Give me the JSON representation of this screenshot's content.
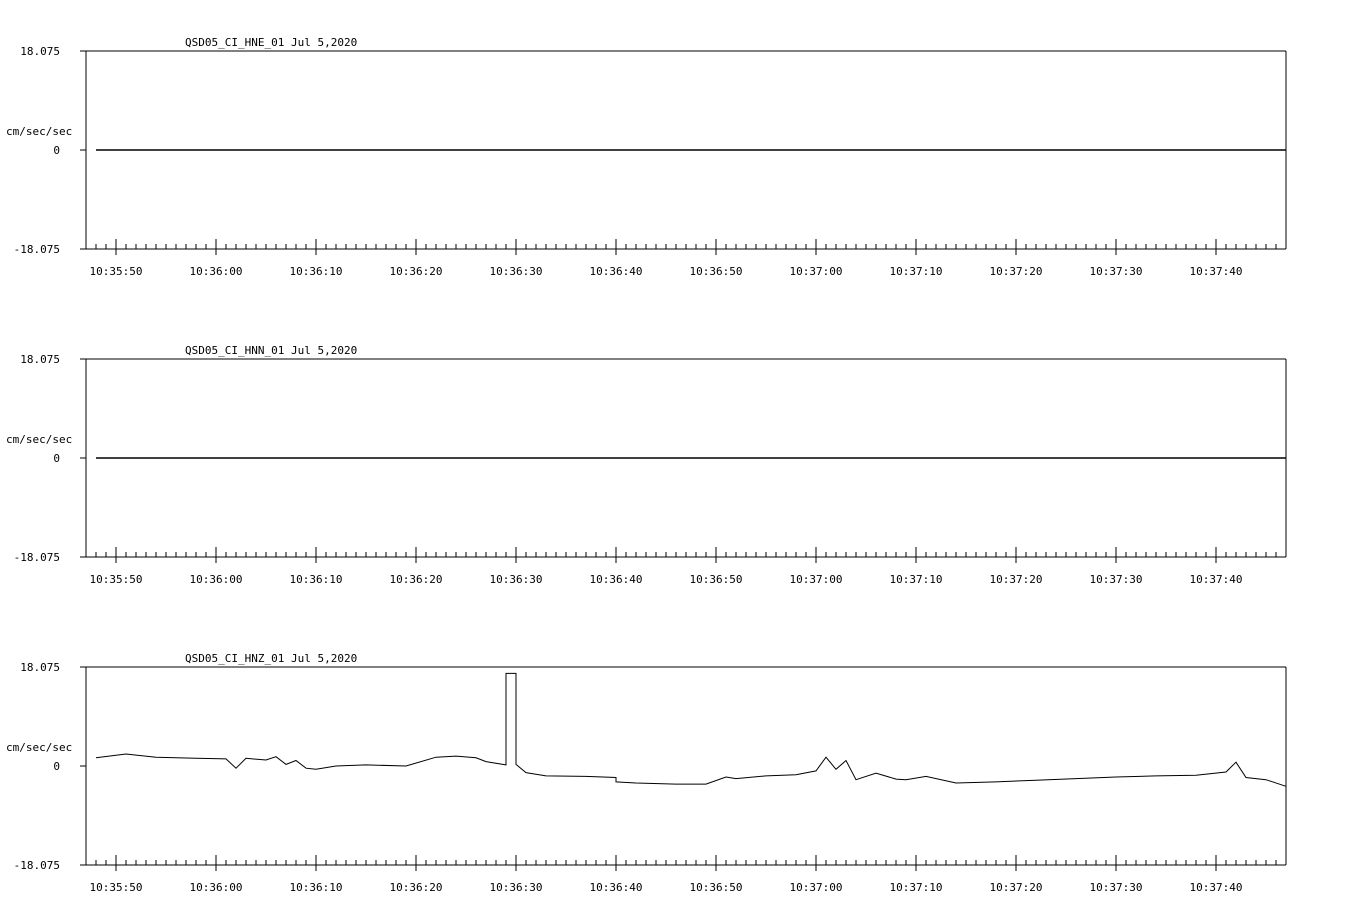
{
  "colors": {
    "background": "#ffffff",
    "trace": "#000000",
    "axis": "#000000"
  },
  "chart_data": [
    {
      "type": "line",
      "title": "QSD05_CI_HNE_01  Jul 5,2020",
      "ylabel": "cm/sec/sec",
      "ylim": [
        -18.075,
        18.075
      ],
      "ytick_labels": [
        "18.075",
        "0",
        "-18.075"
      ],
      "xlim": [
        "10:35:47",
        "10:37:47"
      ],
      "xtick_labels": [
        "10:35:50",
        "10:36:00",
        "10:36:10",
        "10:36:20",
        "10:36:30",
        "10:36:40",
        "10:36:50",
        "10:37:00",
        "10:37:10",
        "10:37:20",
        "10:37:30",
        "10:37:40"
      ],
      "grid": false,
      "series": [
        {
          "x": [
            "10:35:48",
            "10:37:47"
          ],
          "values": [
            0,
            0
          ]
        }
      ]
    },
    {
      "type": "line",
      "title": "QSD05_CI_HNN_01  Jul 5,2020",
      "ylabel": "cm/sec/sec",
      "ylim": [
        -18.075,
        18.075
      ],
      "ytick_labels": [
        "18.075",
        "0",
        "-18.075"
      ],
      "xlim": [
        "10:35:47",
        "10:37:47"
      ],
      "xtick_labels": [
        "10:35:50",
        "10:36:00",
        "10:36:10",
        "10:36:20",
        "10:36:30",
        "10:36:40",
        "10:36:50",
        "10:37:00",
        "10:37:10",
        "10:37:20",
        "10:37:30",
        "10:37:40"
      ],
      "grid": false,
      "series": [
        {
          "x": [
            "10:35:48",
            "10:37:47"
          ],
          "values": [
            0,
            0
          ]
        }
      ]
    },
    {
      "type": "line",
      "title": "QSD05_CI_HNZ_01  Jul 5,2020",
      "ylabel": "cm/sec/sec",
      "ylim": [
        -18.075,
        18.075
      ],
      "ytick_labels": [
        "18.075",
        "0",
        "-18.075"
      ],
      "xlim": [
        "10:35:47",
        "10:37:47"
      ],
      "xtick_labels": [
        "10:35:50",
        "10:36:00",
        "10:36:10",
        "10:36:20",
        "10:36:30",
        "10:36:40",
        "10:36:50",
        "10:37:00",
        "10:37:10",
        "10:37:20",
        "10:37:30",
        "10:37:40"
      ],
      "grid": false,
      "series": [
        {
          "x": [
            "10:35:48",
            "10:35:51",
            "10:35:54",
            "10:35:58",
            "10:36:01",
            "10:36:02",
            "10:36:03",
            "10:36:05",
            "10:36:06",
            "10:36:07",
            "10:36:08",
            "10:36:09",
            "10:36:10",
            "10:36:12",
            "10:36:15",
            "10:36:19",
            "10:36:22",
            "10:36:24",
            "10:36:26",
            "10:36:27",
            "10:36:29",
            "10:36:29",
            "10:36:30",
            "10:36:30",
            "10:36:31",
            "10:36:33",
            "10:36:37",
            "10:36:40",
            "10:36:40",
            "10:36:42",
            "10:36:46",
            "10:36:49",
            "10:36:51",
            "10:36:52",
            "10:36:55",
            "10:36:58",
            "10:37:00",
            "10:37:01",
            "10:37:02",
            "10:37:03",
            "10:37:04",
            "10:37:06",
            "10:37:08",
            "10:37:09",
            "10:37:11",
            "10:37:14",
            "10:37:18",
            "10:37:22",
            "10:37:26",
            "10:37:30",
            "10:37:34",
            "10:37:38",
            "10:37:41",
            "10:37:42",
            "10:37:43",
            "10:37:45",
            "10:37:47"
          ],
          "values": [
            1.5,
            2.2,
            1.6,
            1.4,
            1.3,
            -0.4,
            1.4,
            1.1,
            1.7,
            0.3,
            1.0,
            -0.4,
            -0.6,
            0.0,
            0.2,
            0.0,
            1.6,
            1.8,
            1.5,
            0.8,
            0.2,
            16.9,
            16.9,
            0.3,
            -1.2,
            -1.8,
            -1.9,
            -2.1,
            -2.9,
            -3.1,
            -3.3,
            -3.3,
            -2.0,
            -2.3,
            -1.8,
            -1.6,
            -0.9,
            1.6,
            -0.6,
            1.0,
            -2.5,
            -1.3,
            -2.4,
            -2.5,
            -1.9,
            -3.1,
            -2.9,
            -2.6,
            -2.3,
            -2.0,
            -1.8,
            -1.7,
            -1.1,
            0.7,
            -2.1,
            -2.5,
            -3.7
          ]
        }
      ]
    }
  ]
}
